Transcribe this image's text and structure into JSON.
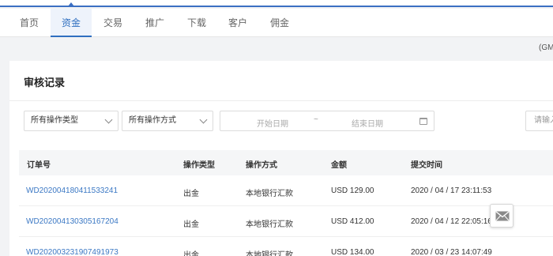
{
  "nav": {
    "items": [
      {
        "label": "首页",
        "active": false
      },
      {
        "label": "资金",
        "active": true
      },
      {
        "label": "交易",
        "active": false
      },
      {
        "label": "推广",
        "active": false
      },
      {
        "label": "下载",
        "active": false
      },
      {
        "label": "客户",
        "active": false
      },
      {
        "label": "佣金",
        "active": false
      }
    ]
  },
  "timezone_fragment": "(GM",
  "panel": {
    "title": "审核记录",
    "filters": {
      "operation_type": "所有操作类型",
      "operation_method": "所有操作方式",
      "start_date_placeholder": "开始日期",
      "separator": "~",
      "end_date_placeholder": "结束日期",
      "search_placeholder": "请输入"
    },
    "table": {
      "headers": [
        "订单号",
        "操作类型",
        "操作方式",
        "金额",
        "提交时间"
      ],
      "rows": [
        {
          "order": "WD202004180411533241",
          "type": "出金",
          "method": "本地银行汇款",
          "amount": "USD 129.00",
          "time": "2020 / 04 / 17 23:11:53"
        },
        {
          "order": "WD202004130305167204",
          "type": "出金",
          "method": "本地银行汇款",
          "amount": "USD 412.00",
          "time": "2020 / 04 / 12 22:05:16"
        },
        {
          "order": "WD202003231907491973",
          "type": "出金",
          "method": "本地银行汇款",
          "amount": "USD 134.00",
          "time": "2020 / 03 / 23 14:07:49"
        }
      ]
    }
  },
  "colors": {
    "accent": "#2f6fc0",
    "link": "#3b78c4"
  }
}
